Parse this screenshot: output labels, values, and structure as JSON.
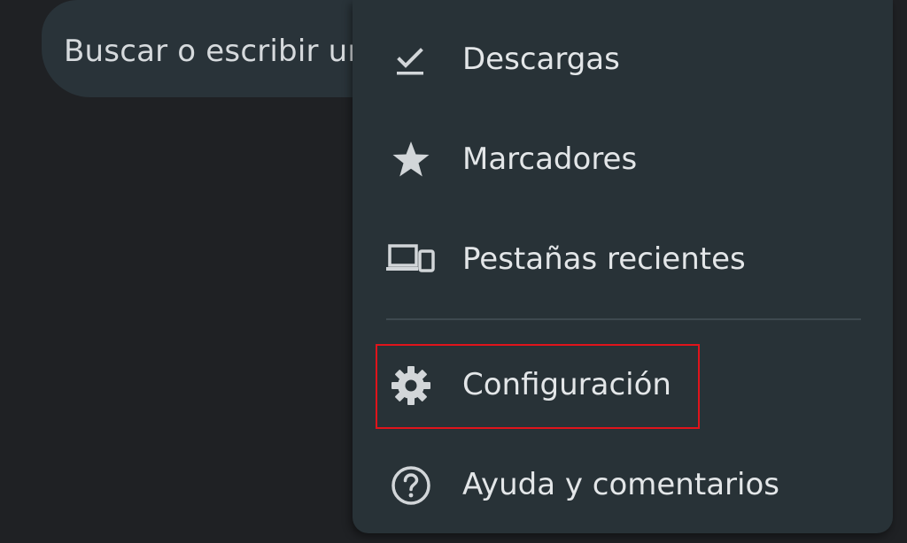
{
  "search": {
    "placeholder_text": "Buscar o escribir ur"
  },
  "menu": {
    "items": [
      {
        "label": "Descargas",
        "icon": "download-done-icon"
      },
      {
        "label": "Marcadores",
        "icon": "star-icon"
      },
      {
        "label": "Pestañas recientes",
        "icon": "devices-icon"
      },
      {
        "label": "Configuración",
        "icon": "gear-icon"
      },
      {
        "label": "Ayuda y comentarios",
        "icon": "help-circle-icon"
      }
    ]
  },
  "colors": {
    "background": "#1f2124",
    "menu_background": "#283237",
    "search_background": "#293339",
    "text": "#e3e6e8",
    "icon": "#d2d6d9",
    "highlight": "#e0141b"
  }
}
